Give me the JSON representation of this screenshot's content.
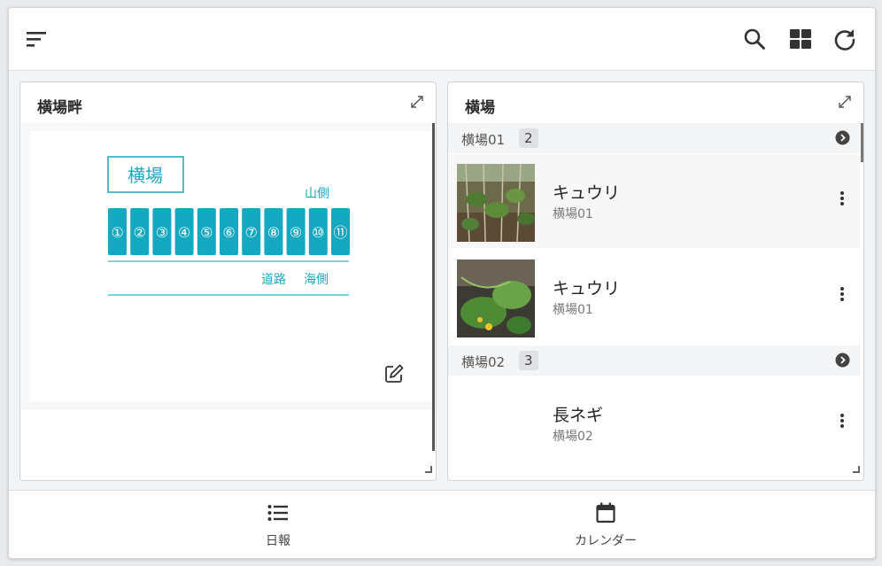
{
  "toolbar": {
    "menu_icon": "sort-lines-icon",
    "search_icon": "search-icon",
    "grid_icon": "grid-view-icon",
    "refresh_icon": "refresh-icon"
  },
  "left_panel": {
    "title": "横場畔",
    "map": {
      "field_label": "横場",
      "mountain_side": "山側",
      "road": "道路",
      "sea_side": "海側",
      "plots": [
        "①",
        "②",
        "③",
        "④",
        "⑤",
        "⑥",
        "⑦",
        "⑧",
        "⑨",
        "⑩",
        "⑪"
      ]
    }
  },
  "right_panel": {
    "title": "横場",
    "groups": [
      {
        "name": "横場01",
        "count": "2",
        "items": [
          {
            "name": "キュウリ",
            "location": "横場01"
          },
          {
            "name": "キュウリ",
            "location": "横場01"
          }
        ]
      },
      {
        "name": "横場02",
        "count": "3",
        "items": [
          {
            "name": "長ネギ",
            "location": "横場02"
          }
        ]
      }
    ]
  },
  "bottom_nav": {
    "daily_report": "日報",
    "calendar": "カレンダー"
  },
  "colors": {
    "accent": "#1aa7bf",
    "plot_fill": "#14a9c0"
  }
}
